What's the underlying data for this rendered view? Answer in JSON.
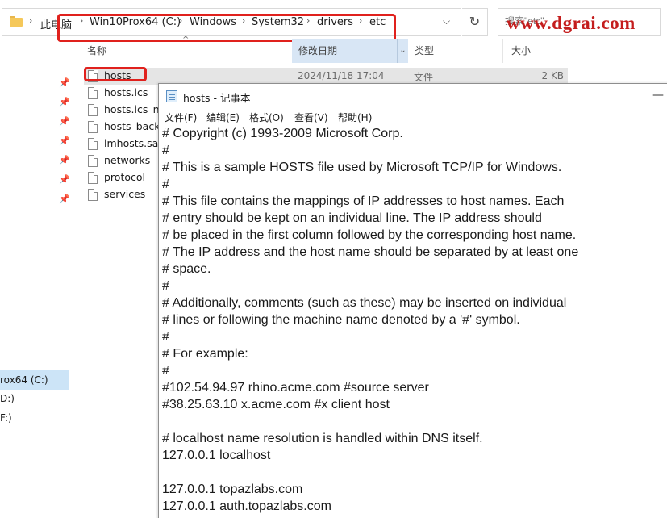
{
  "explorer": {
    "breadcrumb": [
      "此电脑",
      "Win10Prox64 (C:)",
      "Windows",
      "System32",
      "drivers",
      "etc"
    ],
    "refresh_icon": "refresh-icon",
    "search_placeholder": "搜索\"etc\"",
    "watermark": "www.dgrai.com",
    "columns": {
      "name": "名称",
      "date": "修改日期",
      "type": "类型",
      "size": "大小"
    },
    "files": [
      {
        "name": "hosts",
        "date": "2024/11/18 17:04",
        "type": "文件",
        "size": "2 KB"
      },
      {
        "name": "hosts.ics",
        "date": "",
        "type": "",
        "size": ""
      },
      {
        "name": "hosts.ics_ne",
        "date": "",
        "type": "",
        "size": ""
      },
      {
        "name": "hosts_backu",
        "date": "",
        "type": "",
        "size": ""
      },
      {
        "name": "lmhosts.sam",
        "date": "",
        "type": "",
        "size": ""
      },
      {
        "name": "networks",
        "date": "",
        "type": "",
        "size": ""
      },
      {
        "name": "protocol",
        "date": "",
        "type": "",
        "size": ""
      },
      {
        "name": "services",
        "date": "",
        "type": "",
        "size": ""
      }
    ],
    "nav_drives": [
      "rox64 (C:)",
      "D:)",
      "F:)"
    ]
  },
  "notepad": {
    "title": "hosts - 记事本",
    "menus": [
      "文件(F)",
      "编辑(E)",
      "格式(O)",
      "查看(V)",
      "帮助(H)"
    ],
    "lines": [
      "# Copyright (c) 1993-2009 Microsoft Corp.",
      "#",
      "# This is a sample HOSTS file used by Microsoft TCP/IP for Windows.",
      "#",
      "# This file contains the mappings of IP addresses to host names. Each",
      "# entry should be kept on an individual line. The IP address should",
      "# be placed in the first column followed by the corresponding host name.",
      "# The IP address and the host name should be separated by at least one",
      "# space.",
      "#",
      "# Additionally, comments (such as these) may be inserted on individual",
      "# lines or following the machine name denoted by a '#' symbol.",
      "#",
      "# For example:",
      "#",
      "#102.54.94.97 rhino.acme.com #source server",
      "#38.25.63.10 x.acme.com #x client host",
      "",
      "# localhost name resolution is handled within DNS itself.",
      "127.0.0.1 localhost",
      "",
      "127.0.0.1 topazlabs.com",
      "127.0.0.1 auth.topazlabs.com"
    ]
  }
}
